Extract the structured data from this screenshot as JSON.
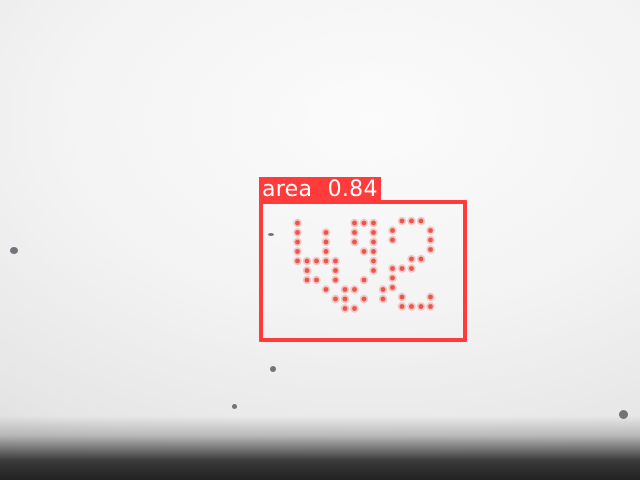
{
  "detection": {
    "class_name": "area",
    "confidence": "0.84",
    "box_color": "#ff3b3b",
    "label_text_color": "#ffffff"
  },
  "dot_matrix": {
    "dot_color": "#e9564e",
    "glow_color": "#f3a19b"
  }
}
